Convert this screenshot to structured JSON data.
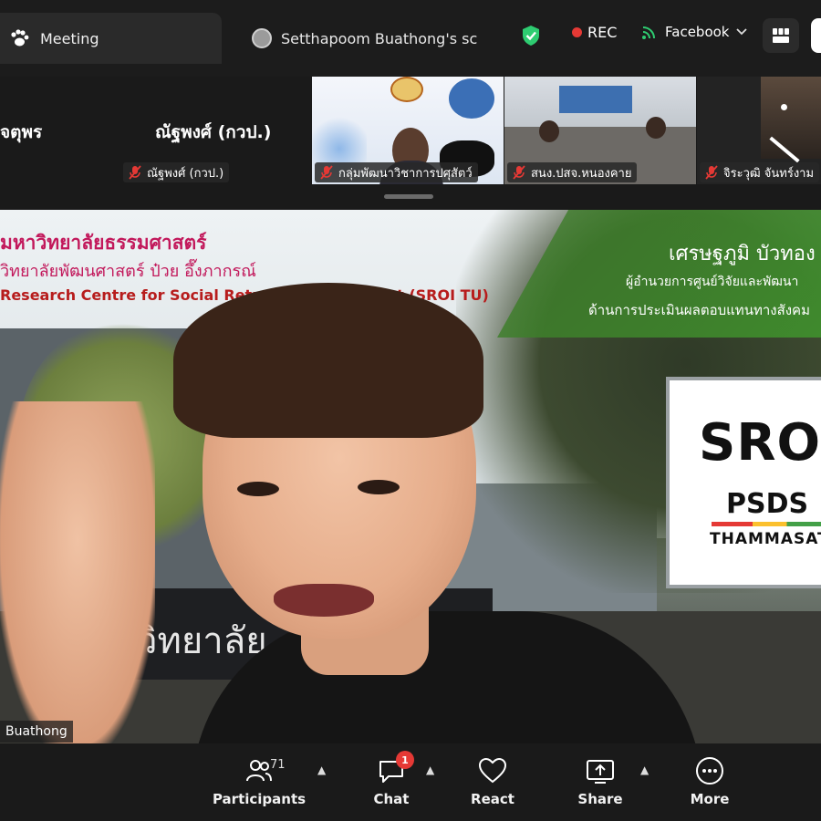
{
  "tabs": {
    "meeting_label": "Meeting",
    "share_tab_label": "Setthapoom Buathong's sc"
  },
  "status": {
    "rec_label": "REC",
    "stream_label": "Facebook"
  },
  "strip": {
    "tile1_name": "จตุพร",
    "tile2_name": "ณัฐพงศ์ (กวป.)",
    "tile2_tag": "ณัฐพงศ์ (กวป.)",
    "tile3_tag": "กลุ่มพัฒนาวิชาการปศุสัตว์",
    "tile4_tag": "สนง.ปสจ.หนองคาย",
    "tile5_tag": "จิระวุฒิ จันทร์งาม"
  },
  "main_video": {
    "uni_th": "มหาวิทยาลัยธรรมศาสตร์",
    "uni_sub": "วิทยาลัยพัฒนศาสตร์ ป๋วย อึ๊งภากรณ์",
    "uni_en": "Research Centre for Social Return on Investment (SROI TU)",
    "speaker_name": "เศรษฐภูมิ บัวทอง",
    "speaker_title1": "ผู้อำนวยการศูนย์วิจัยและพัฒนา",
    "speaker_title2": "ด้านการประเมินผลตอบแทนทางสังคม",
    "card_big": "SROI",
    "card_mid": "PSDS",
    "card_small": "THAMMASAT",
    "sign_text": "วิทยาลัย",
    "name_label": "Buathong"
  },
  "toolbar": {
    "participants_label": "Participants",
    "participants_count": "71",
    "chat_label": "Chat",
    "chat_badge": "1",
    "react_label": "React",
    "share_label": "Share",
    "more_label": "More"
  },
  "colors": {
    "rec_dot": "#e53935",
    "shield": "#2ecc71",
    "badge": "#e53935"
  }
}
